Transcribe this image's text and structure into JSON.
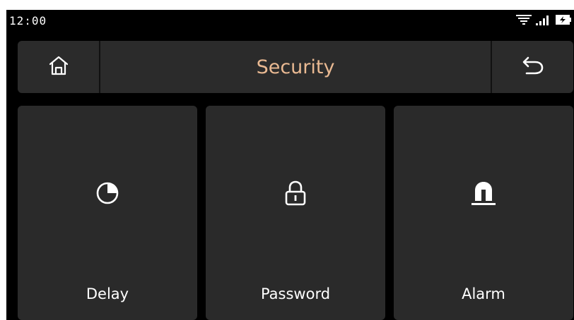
{
  "status_bar": {
    "time": "12:00",
    "icons": [
      "wifi-icon",
      "signal-icon",
      "battery-icon"
    ]
  },
  "header": {
    "title": "Security",
    "left_icon": "home-icon",
    "right_icon": "back-icon",
    "title_color": "#e9b992"
  },
  "tiles": [
    {
      "label": "Delay",
      "icon": "timer-icon"
    },
    {
      "label": "Password",
      "icon": "lock-icon"
    },
    {
      "label": "Alarm",
      "icon": "alarm-siren-icon"
    }
  ],
  "colors": {
    "background": "#000000",
    "panel": "#2b2b2b",
    "text": "#ffffff",
    "accent": "#e9b992"
  }
}
